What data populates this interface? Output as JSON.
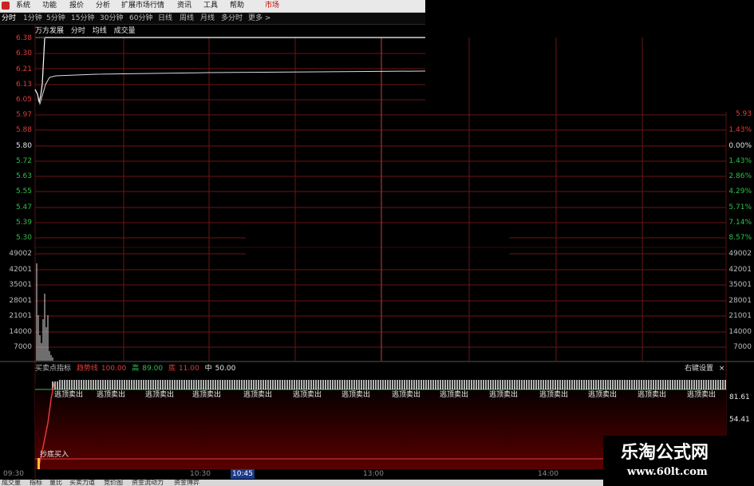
{
  "menubar": {
    "items": [
      {
        "label": "系统"
      },
      {
        "label": "功能"
      },
      {
        "label": "报价"
      },
      {
        "label": "分析"
      },
      {
        "label": "扩展市场行情"
      },
      {
        "label": "资讯"
      },
      {
        "label": "工具"
      },
      {
        "label": "帮助"
      },
      {
        "label": "市场"
      }
    ]
  },
  "periods": {
    "items": [
      {
        "label": "分时"
      },
      {
        "label": "1分钟"
      },
      {
        "label": "5分钟"
      },
      {
        "label": "15分钟"
      },
      {
        "label": "30分钟"
      },
      {
        "label": "60分钟"
      },
      {
        "label": "日线"
      },
      {
        "label": "周线"
      },
      {
        "label": "月线"
      },
      {
        "label": "多分时"
      },
      {
        "label": "更多 >"
      }
    ]
  },
  "stock": {
    "name": "万方发展",
    "mode": "分时",
    "avg_label": "均线",
    "volume_label": "成交量"
  },
  "price_axis": {
    "top_labels": [
      "6.38",
      "6.30",
      "6.21",
      "6.13",
      "6.05"
    ],
    "labels": [
      "5.97",
      "5.88",
      "5.80",
      "5.72",
      "5.63",
      "5.55",
      "5.47",
      "5.39",
      "5.30"
    ],
    "pct_top": "5.93",
    "pct_labels": [
      "1.43%",
      "0.00%",
      "1.43%",
      "2.86%",
      "4.29%",
      "5.71%",
      "7.14%",
      "8.57%"
    ]
  },
  "volume_axis": {
    "labels": [
      "49002",
      "42001",
      "35001",
      "28001",
      "21001",
      "14000",
      "7000"
    ]
  },
  "indicator": {
    "name": "买卖点指标",
    "line_label": "趋势线",
    "line_value": "100.00",
    "high_label": "高",
    "high_value": "89.00",
    "low_label": "底",
    "low_value": "11.00",
    "mid_label": "中",
    "mid_value": "50.00",
    "right_settings": "右键设置",
    "close_glyph": "×",
    "right_labels": [
      "81.61",
      "54.41"
    ],
    "sell_text": "逃顶卖出",
    "buy_text": "抄底买入"
  },
  "time_axis": {
    "labels": [
      "09:30",
      "10:30",
      "10:45",
      "13:00",
      "14:00"
    ]
  },
  "bottom_tabs": {
    "items": [
      {
        "label": "成交量"
      },
      {
        "label": "指标"
      },
      {
        "label": "量比"
      },
      {
        "label": "买卖力道"
      },
      {
        "label": "竞价图"
      },
      {
        "label": "资金流动力"
      },
      {
        "label": "资金博弈"
      }
    ]
  },
  "watermark": {
    "title": "乐淘公式网",
    "url": "www.60lt.com"
  },
  "colors": {
    "grid": "#6e1414",
    "price_line": "#ffffff",
    "buy_line": "#e23b3b",
    "up": "#e23b3b",
    "flat": "#e8e8e8"
  }
}
